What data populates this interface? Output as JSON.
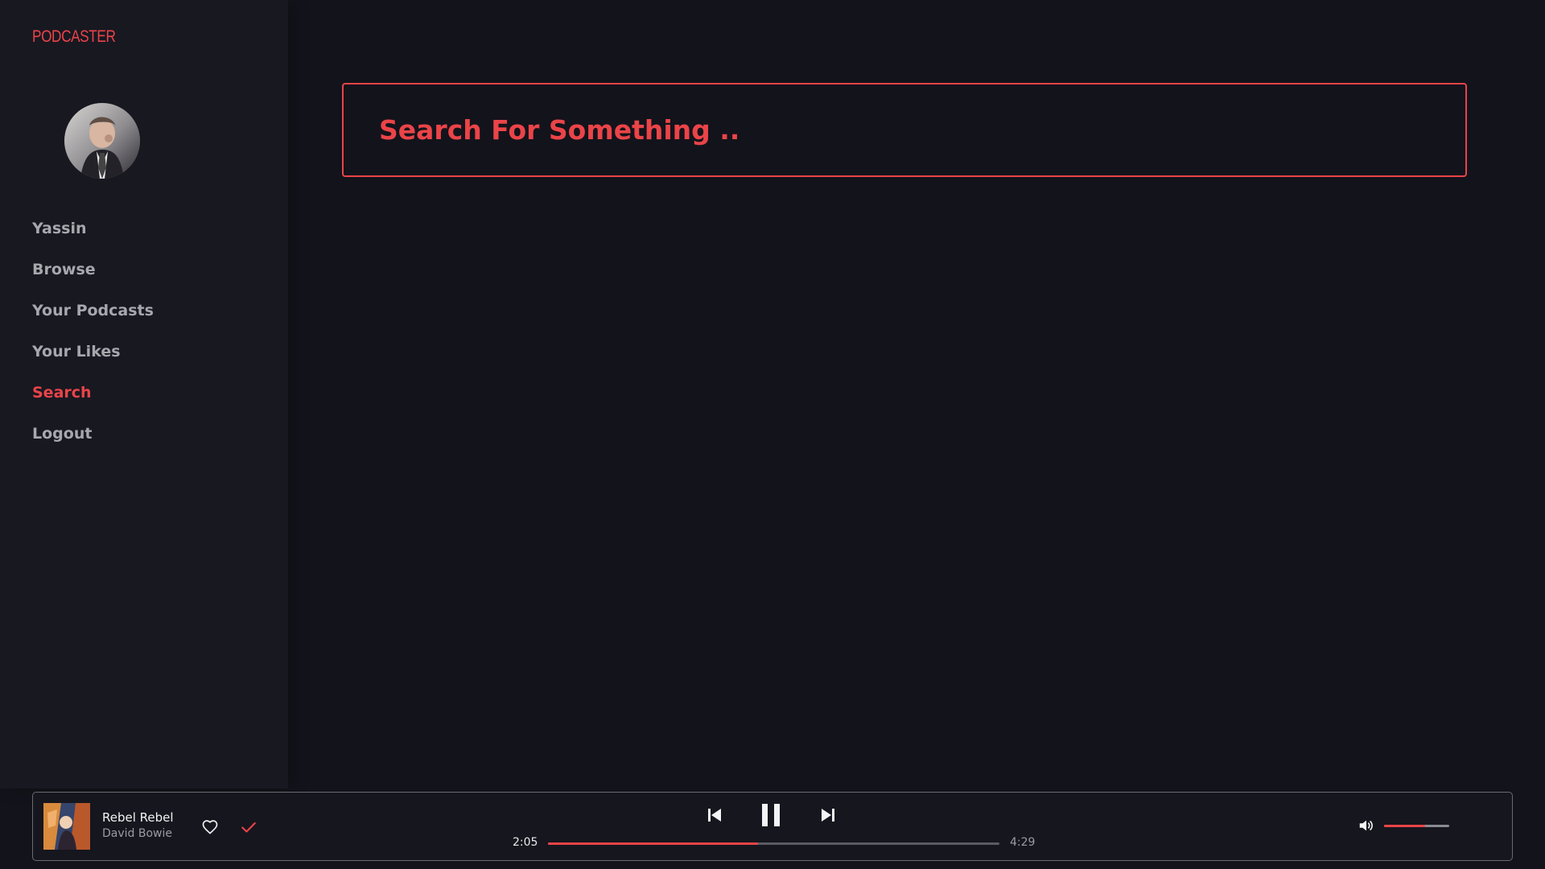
{
  "app": {
    "brand": "PODCASTER"
  },
  "sidebar": {
    "avatar_icon": "user-avatar",
    "items": [
      {
        "label": "Yassin"
      },
      {
        "label": "Browse"
      },
      {
        "label": "Your Podcasts"
      },
      {
        "label": "Your Likes"
      },
      {
        "label": "Search"
      },
      {
        "label": "Logout"
      }
    ],
    "active_item": "Search"
  },
  "search": {
    "placeholder": "Search For Something ..",
    "value": ""
  },
  "player": {
    "track_title": "Rebel Rebel",
    "track_artist": "David Bowie",
    "current_time": "2:05",
    "total_time": "4:29",
    "progress_fraction": 0.466,
    "volume_fraction": 0.63,
    "icons": {
      "like": "heart-icon",
      "saved": "check-icon",
      "previous": "skip-back-icon",
      "pause": "pause-icon",
      "next": "skip-forward-icon",
      "volume": "volume-icon"
    }
  },
  "colors": {
    "accent": "#ea4448",
    "background": "#13131b",
    "sidebar": "#181821",
    "text_muted": "#a7a7ad"
  }
}
